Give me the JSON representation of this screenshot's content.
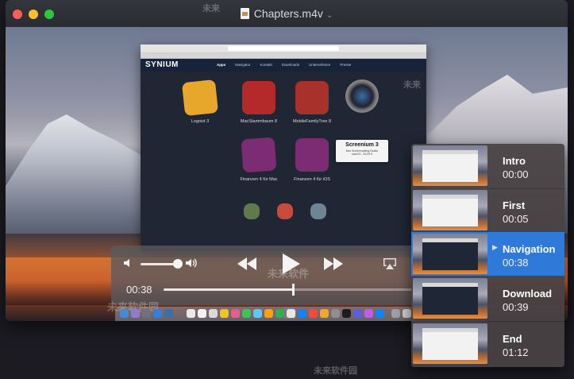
{
  "window": {
    "title": "Chapters.m4v"
  },
  "browser": {
    "logo": "SYNIUM",
    "menu": [
      "Apps",
      "Navigator",
      "Kontakt",
      "Downloads",
      "Unternehmen",
      "Presse"
    ],
    "apps": [
      {
        "label": "Logoist 3",
        "color": "#e7a72a"
      },
      {
        "label": "MacStammbaum 8",
        "color": "#b42a2a"
      },
      {
        "label": "MobileFamilyTree 8",
        "color": "#a8312c"
      },
      {
        "label": "Finanzen 4 für Mac",
        "color": "#7b2c73"
      },
      {
        "label": "Finanzen 4 für iOS",
        "color": "#7b2c73"
      }
    ],
    "tooltip": {
      "title": "Screenium 3",
      "subtitle": "Das Screencasting-Studio",
      "price": "macOS - 59,99 €"
    }
  },
  "controls": {
    "current_time": "00:38",
    "progress": 0.51,
    "volume": 0.9
  },
  "return_glyph": "↩",
  "chapters": [
    {
      "title": "Intro",
      "time": "00:00",
      "selected": false
    },
    {
      "title": "First",
      "time": "00:05",
      "selected": false
    },
    {
      "title": "Navigation",
      "time": "00:38",
      "selected": true
    },
    {
      "title": "Download",
      "time": "00:39",
      "selected": false
    },
    {
      "title": "End",
      "time": "01:12",
      "selected": false
    }
  ],
  "colors": {
    "selected": "#2f7ad8",
    "close": "#ff5f57",
    "minimize": "#febc2e",
    "zoom": "#28c840"
  }
}
